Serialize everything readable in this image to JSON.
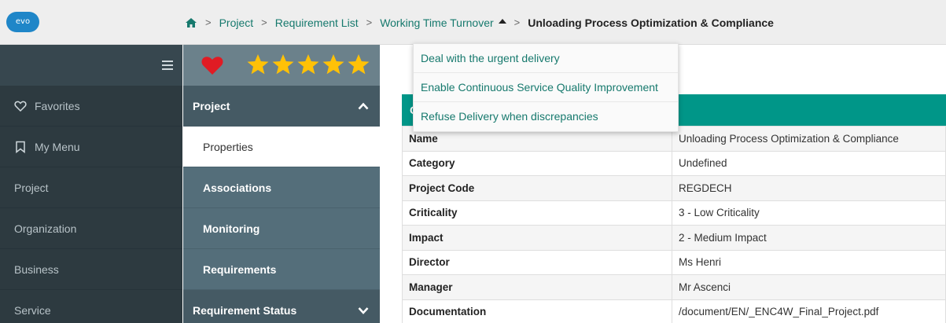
{
  "app": {
    "logo_text": "evo"
  },
  "breadcrumb": {
    "items": [
      "Project",
      "Requirement List",
      "Working Time Turnover"
    ],
    "current": "Unloading Process Optimization & Compliance",
    "separator": ">"
  },
  "dropdown": {
    "items": [
      "Deal with the urgent delivery",
      "Enable Continuous Service Quality Improvement",
      "Refuse Delivery when discrepancies"
    ]
  },
  "sidebar": {
    "items": [
      {
        "label": "Favorites",
        "icon": "heart-outline-icon"
      },
      {
        "label": "My Menu",
        "icon": "bookmark-icon"
      },
      {
        "label": "Project"
      },
      {
        "label": "Organization"
      },
      {
        "label": "Business"
      },
      {
        "label": "Service"
      }
    ]
  },
  "subpanel": {
    "rating": 5,
    "rating_max": 5,
    "section": "Project",
    "items": [
      "Properties",
      "Associations",
      "Monitoring",
      "Requirements"
    ],
    "active_item": "Properties",
    "next_section": "Requirement Status"
  },
  "main": {
    "header_text": "G",
    "properties": [
      {
        "key": "Name",
        "value": "Unloading Process Optimization & Compliance"
      },
      {
        "key": "Category",
        "value": "Undefined"
      },
      {
        "key": "Project Code",
        "value": "REGDECH"
      },
      {
        "key": "Criticality",
        "value": "3 - Low Criticality"
      },
      {
        "key": "Impact",
        "value": "2 - Medium Impact"
      },
      {
        "key": "Director",
        "value": "Ms Henri"
      },
      {
        "key": "Manager",
        "value": "Mr Ascenci"
      },
      {
        "key": "Documentation",
        "value": "/document/EN/_ENC4W_Final_Project.pdf"
      }
    ]
  },
  "colors": {
    "accent": "#009688",
    "link": "#16796d",
    "sidebar_bg": "#2d3a40",
    "subpanel_bg": "#546e7a",
    "heart": "#e01b24",
    "star": "#ffc107"
  }
}
